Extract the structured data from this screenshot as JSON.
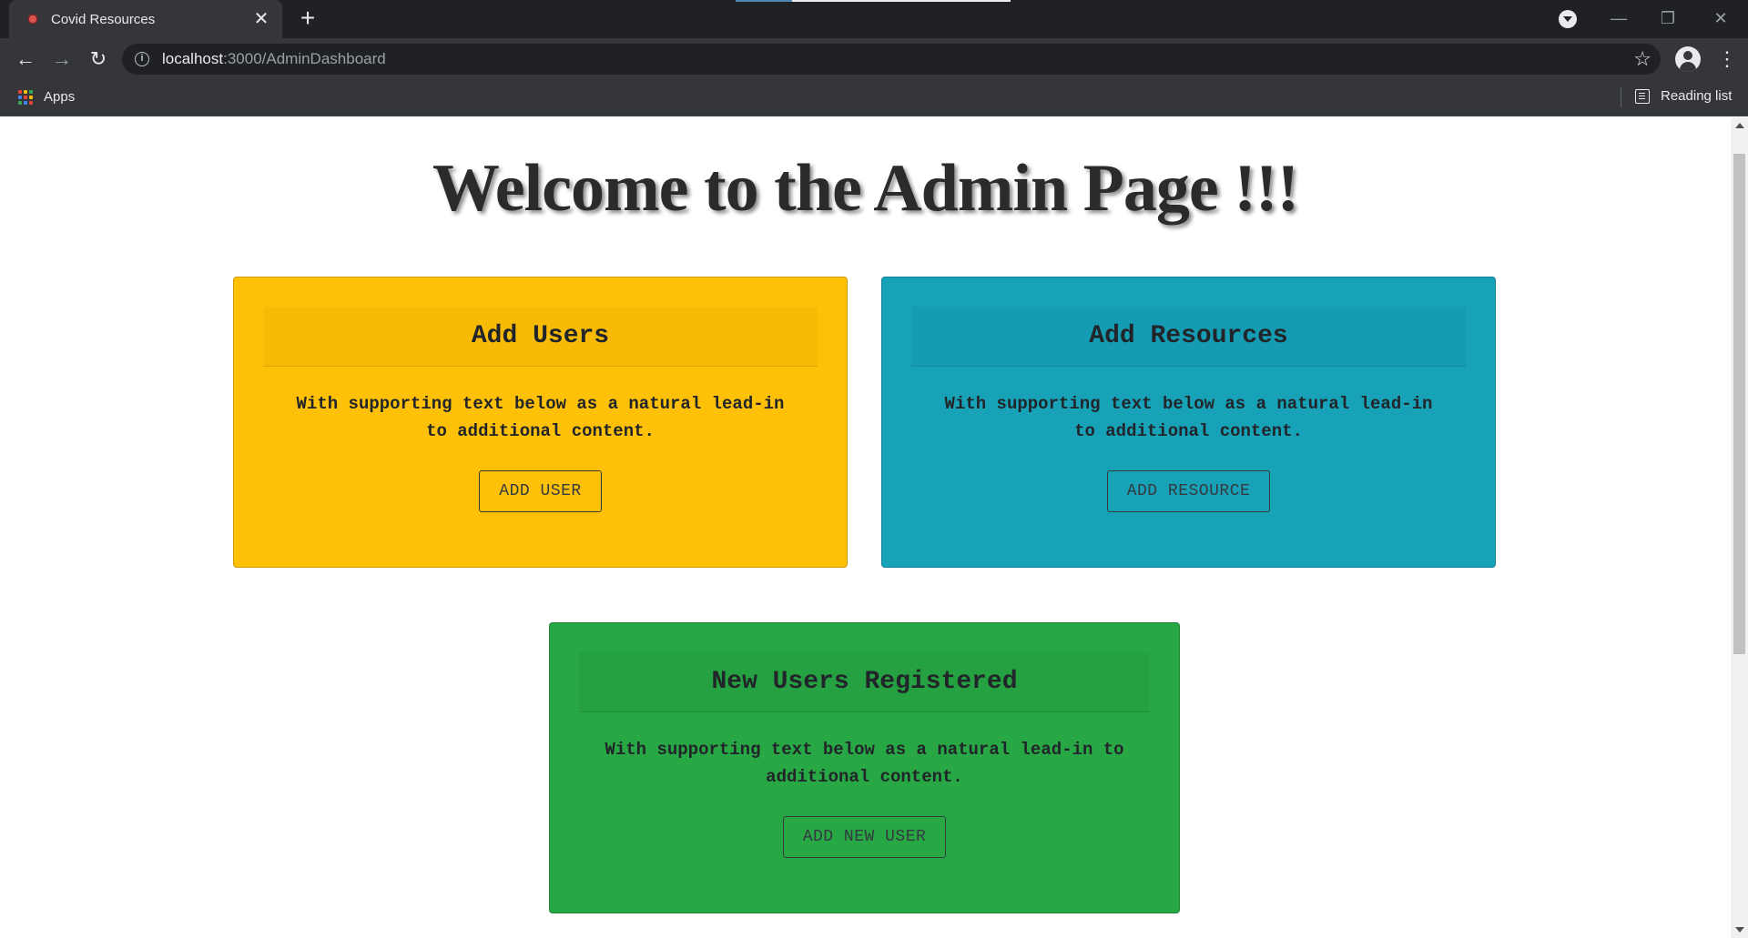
{
  "browser": {
    "tab_title": "Covid Resources",
    "tab_close": "✕",
    "new_tab": "+",
    "url_host": "localhost",
    "url_path": ":3000/AdminDashboard",
    "bookmarks": {
      "apps_label": "Apps",
      "reading_list_label": "Reading list"
    }
  },
  "page": {
    "title": "Welcome to the Admin Page !!!",
    "cards": [
      {
        "header": "Add Users",
        "text": "With supporting text below as a natural lead-in to additional content.",
        "button": "ADD USER",
        "color": "#ffc107"
      },
      {
        "header": "Add Resources",
        "text": "With supporting text below as a natural lead-in to additional content.",
        "button": "ADD RESOURCE",
        "color": "#17a2b8"
      },
      {
        "header": "New Users Registered",
        "text": "With supporting text below as a natural lead-in to additional content.",
        "button": "ADD NEW USER",
        "color": "#28a745"
      }
    ]
  },
  "icons": [
    "favicon-icon",
    "close-icon",
    "plus-icon",
    "tab-search-icon",
    "minimize-icon",
    "restore-icon",
    "window-close-icon",
    "back-icon",
    "forward-icon",
    "reload-icon",
    "info-icon",
    "star-icon",
    "profile-icon",
    "menu-icon",
    "apps-icon",
    "reading-list-icon"
  ]
}
